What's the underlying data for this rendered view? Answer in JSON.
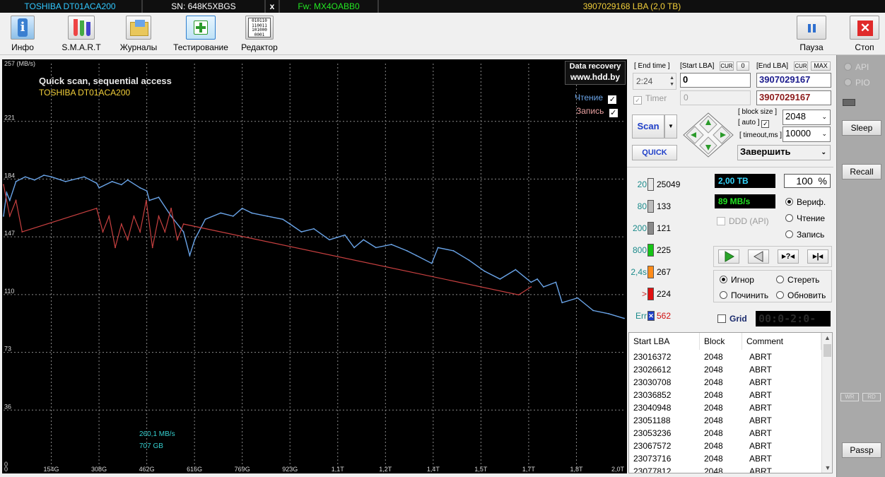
{
  "topbar": {
    "model": "TOSHIBA DT01ACA200",
    "serial": "SN: 648K5XBGS",
    "close": "x",
    "firmware": "Fw: MX4OABB0",
    "capacity": "3907029168 LBA (2,0 TB)"
  },
  "toolbar": {
    "info": "Инфо",
    "smart": "S.M.A.R.T",
    "logs": "Журналы",
    "testing": "Тестирование",
    "editor": "Редактор",
    "pause": "Пауза",
    "stop": "Стоп",
    "editor_icon_text": "010110\n110011\n101000\n0001"
  },
  "chart_data": {
    "type": "line",
    "title": "Quick scan, sequential access",
    "subtitle": "TOSHIBA DT01ACA200",
    "ylabel": "(MB/s)",
    "ylim": [
      0,
      257
    ],
    "y_ticks": [
      "257 (MB/s)",
      "221",
      "184",
      "147",
      "110",
      "73",
      "36",
      "0"
    ],
    "x_ticks": [
      "0",
      "154G",
      "308G",
      "462G",
      "616G",
      "769G",
      "923G",
      "1,1T",
      "1,2T",
      "1,4T",
      "1,5T",
      "1,7T",
      "1,8T",
      "2,0T"
    ],
    "watermark": [
      "Data recovery",
      "www.hdd.by"
    ],
    "legend": [
      {
        "name": "Чтение",
        "checked": true,
        "color": "#6aa4e8"
      },
      {
        "name": "Запись",
        "checked": true,
        "color": "#e8a0a0"
      }
    ],
    "cursor_labels": [
      "260,1 MB/s",
      "707 GB"
    ],
    "grid": true,
    "series": [
      {
        "name": "Чтение",
        "color": "#6aa4e8",
        "x": [
          0,
          10,
          20,
          40,
          70,
          100,
          130,
          154,
          200,
          260,
          300,
          308,
          350,
          380,
          400,
          440,
          462,
          470,
          500,
          540,
          580,
          600,
          616,
          650,
          700,
          740,
          769,
          800,
          850,
          900,
          923,
          960,
          1000,
          1050,
          1100,
          1130,
          1160,
          1200,
          1250,
          1300,
          1330,
          1380,
          1400,
          1450,
          1500,
          1550,
          1600,
          1650,
          1700,
          1720,
          1740,
          1780,
          1800,
          1850,
          1900,
          1950,
          2000
        ],
        "y": [
          160,
          175,
          170,
          182,
          185,
          183,
          186,
          185,
          182,
          185,
          181,
          178,
          182,
          180,
          183,
          178,
          176,
          170,
          172,
          160,
          150,
          135,
          145,
          158,
          162,
          160,
          165,
          162,
          160,
          158,
          155,
          150,
          152,
          145,
          148,
          140,
          145,
          140,
          142,
          138,
          135,
          130,
          140,
          138,
          132,
          125,
          120,
          126,
          118,
          120,
          115,
          118,
          105,
          108,
          100,
          98,
          95
        ]
      },
      {
        "name": "Запись",
        "color": "#c84040",
        "x": [
          0,
          20,
          40,
          60,
          300,
          320,
          340,
          360,
          380,
          400,
          420,
          440,
          460,
          480,
          500,
          520,
          540,
          560,
          580,
          1660,
          1700
        ],
        "y": [
          180,
          160,
          170,
          150,
          165,
          150,
          160,
          140,
          155,
          145,
          160,
          150,
          170,
          140,
          160,
          150,
          165,
          145,
          155,
          110,
          115
        ]
      }
    ]
  },
  "controls": {
    "end_time_label": "[ End time ]",
    "end_time_value": "2:24",
    "start_lba_label": "[Start LBA]",
    "cur_label": "CUR",
    "zero_label": "0",
    "start_lba_value": "0",
    "end_lba_label": "[End LBA]",
    "max_label": "MAX",
    "end_lba_value": "3907029167",
    "end_lba_value2": "3907029167",
    "timer_label": "Timer",
    "timer_value": "0",
    "scan_label": "Scan",
    "quick_label": "QUICK",
    "block_size_label": "[ block size ]",
    "auto_label": "[ auto ]",
    "timeout_label": "[ timeout,ms ]",
    "block_size_value": "2048",
    "timeout_value": "10000",
    "finish_label": "Завершить"
  },
  "stats": {
    "rows": [
      {
        "label": "20",
        "count": "25049",
        "color": "#e8e8e8"
      },
      {
        "label": "80",
        "count": "133",
        "color": "#bdbdbd"
      },
      {
        "label": "200",
        "count": "121",
        "color": "#8a8a8a"
      },
      {
        "label": "800",
        "count": "225",
        "color": "#16c516"
      },
      {
        "label": "2,4s",
        "count": "267",
        "color": "#ff8c1a"
      },
      {
        "label": ">",
        "count": "224",
        "color": "#e01010"
      },
      {
        "label": "Err",
        "count": "562",
        "color": "#1f3fc8"
      }
    ],
    "size_value": "2,00 ТВ",
    "speed_value": "89 MB/s",
    "percent_value": "100",
    "percent_sign": "%",
    "ddd_label": "DDD (API)",
    "mode_verify": "Вериф.",
    "mode_read": "Чтение",
    "mode_write": "Запись",
    "action_ignore": "Игнор",
    "action_erase": "Стереть",
    "action_repair": "Починить",
    "action_refresh": "Обновить",
    "grid_label": "Grid",
    "timer_display": "00:0-2:0-"
  },
  "side": {
    "api": "API",
    "pio": "PIO",
    "sleep": "Sleep",
    "recall": "Recall",
    "wr": "WR",
    "rd": "RD",
    "passp": "Passp"
  },
  "table": {
    "headers": [
      "Start LBA",
      "Block",
      "Comment"
    ],
    "rows": [
      [
        "23016372",
        "2048",
        "ABRT"
      ],
      [
        "23026612",
        "2048",
        "ABRT"
      ],
      [
        "23030708",
        "2048",
        "ABRT"
      ],
      [
        "23036852",
        "2048",
        "ABRT"
      ],
      [
        "23040948",
        "2048",
        "ABRT"
      ],
      [
        "23051188",
        "2048",
        "ABRT"
      ],
      [
        "23053236",
        "2048",
        "ABRT"
      ],
      [
        "23067572",
        "2048",
        "ABRT"
      ],
      [
        "23073716",
        "2048",
        "ABRT"
      ],
      [
        "23077812",
        "2048",
        "ABRT"
      ]
    ]
  }
}
